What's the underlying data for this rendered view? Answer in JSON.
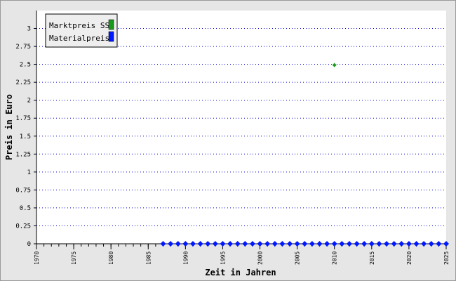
{
  "chart_data": {
    "type": "scatter",
    "title": "",
    "xlabel": "Zeit in Jahren",
    "ylabel": "Preis in Euro",
    "xlim": [
      1970,
      2025
    ],
    "ylim": [
      0,
      3.25
    ],
    "x_ticks": [
      "1970",
      "1975",
      "1980",
      "1985",
      "1990",
      "1995",
      "2000",
      "2005",
      "2010",
      "2015",
      "2020",
      "2025"
    ],
    "y_ticks": [
      "0",
      "0.25",
      "0.5",
      "0.75",
      "1",
      "1.25",
      "1.5",
      "1.75",
      "2",
      "2.25",
      "2.5",
      "2.75",
      "3"
    ],
    "grid": "horizontal dotted",
    "legend_position": "top-left",
    "series": [
      {
        "name": "Marktpreis SS",
        "color": "#1a9a1a",
        "points": [
          [
            2010,
            2.49
          ]
        ]
      },
      {
        "name": "Materialpreis",
        "color": "#0018ff",
        "points": [
          [
            1987,
            0
          ],
          [
            1988,
            0
          ],
          [
            1989,
            0
          ],
          [
            1990,
            0
          ],
          [
            1991,
            0
          ],
          [
            1992,
            0
          ],
          [
            1993,
            0
          ],
          [
            1994,
            0
          ],
          [
            1995,
            0
          ],
          [
            1996,
            0
          ],
          [
            1997,
            0
          ],
          [
            1998,
            0
          ],
          [
            1999,
            0
          ],
          [
            2000,
            0
          ],
          [
            2001,
            0
          ],
          [
            2002,
            0
          ],
          [
            2003,
            0
          ],
          [
            2004,
            0
          ],
          [
            2005,
            0
          ],
          [
            2006,
            0
          ],
          [
            2007,
            0
          ],
          [
            2008,
            0
          ],
          [
            2009,
            0
          ],
          [
            2010,
            0
          ],
          [
            2011,
            0
          ],
          [
            2012,
            0
          ],
          [
            2013,
            0
          ],
          [
            2014,
            0
          ],
          [
            2015,
            0
          ],
          [
            2016,
            0
          ],
          [
            2017,
            0
          ],
          [
            2018,
            0
          ],
          [
            2019,
            0
          ],
          [
            2020,
            0
          ],
          [
            2021,
            0
          ],
          [
            2022,
            0
          ],
          [
            2023,
            0
          ],
          [
            2024,
            0
          ],
          [
            2025,
            0
          ]
        ]
      }
    ]
  }
}
